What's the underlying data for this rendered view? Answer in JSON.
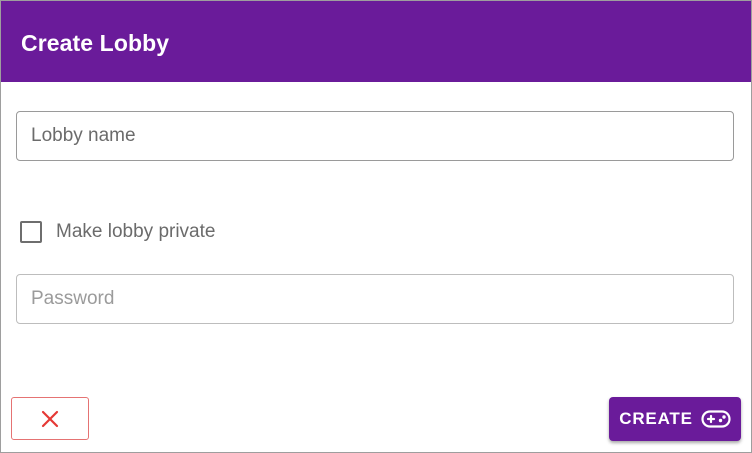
{
  "colors": {
    "accent": "#6a1b9a",
    "cancel": "#e53935"
  },
  "dialog": {
    "title": "Create Lobby"
  },
  "form": {
    "lobby_name": {
      "value": "",
      "placeholder": "Lobby name"
    },
    "private_checkbox": {
      "checked": false,
      "label": "Make lobby private"
    },
    "password": {
      "value": "",
      "placeholder": "Password"
    }
  },
  "actions": {
    "cancel_icon": "close-icon",
    "create_label": "CREATE",
    "create_icon": "gamepad-icon"
  }
}
